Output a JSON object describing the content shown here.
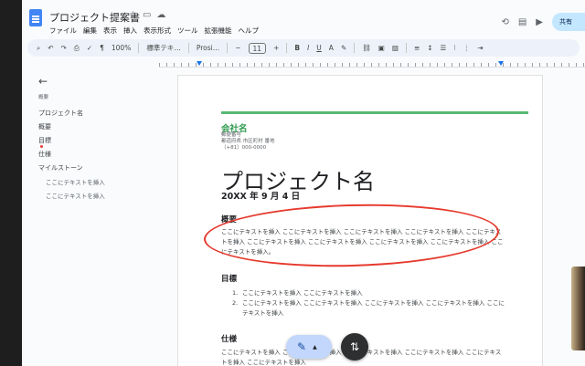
{
  "document": {
    "title": "プロジェクト提案書"
  },
  "menu": [
    "ファイル",
    "編集",
    "表示",
    "挿入",
    "表示形式",
    "ツール",
    "拡張機能",
    "ヘルプ"
  ],
  "share": {
    "label": "共有"
  },
  "toolbar": {
    "zoom": "100%",
    "style": "標準テキ…",
    "font": "Prosi…",
    "font_size": "11",
    "bold": "B",
    "italic": "I",
    "underline": "U",
    "text_color": "A"
  },
  "outline": {
    "back": "←",
    "header": "概要",
    "items": [
      {
        "label": "プロジェクト名"
      },
      {
        "label": "概要"
      },
      {
        "label": "目標"
      },
      {
        "label": "仕様"
      },
      {
        "label": "マイルストーン"
      },
      {
        "label": "ここにテキストを挿入"
      },
      {
        "label": "ここにテキストを挿入"
      }
    ]
  },
  "page": {
    "company": "会社名",
    "address_lines": [
      "郵便番号",
      "都道府県 市区町村 番地",
      "（+81）000-0000"
    ],
    "project_title": "プロジェクト名",
    "date": "20XX 年 9 月 4 日",
    "overview_heading": "概要",
    "overview_text": "ここにテキストを挿入 ここにテキストを挿入 ここにテキストを挿入 ここにテキストを挿入 ここにテキストを挿入 ここにテキストを挿入 ここにテキストを挿入 ここにテキストを挿入 ここにテキストを挿入 ここにテキストを挿入。",
    "goal_heading": "目標",
    "goal_items": [
      {
        "num": "1.",
        "text": "ここにテキストを挿入 ここにテキストを挿入"
      },
      {
        "num": "2.",
        "text": "ここにテキストを挿入 ここにテキストを挿入 ここにテキストを挿入 ここにテキストを挿入 ここにテキストを挿入"
      }
    ],
    "spec_heading": "仕様",
    "spec_text": "ここにテキストを挿入 ここにテキストを挿入 ここにテキストを挿入 ここにテキストを挿入 ここにテキストを挿入 ここにテキストを挿入"
  },
  "colors": {
    "accent_green": "#5bb974",
    "annotation_red": "#e63a2e",
    "toolbar_bg": "#edf2fa",
    "share_bg": "#c2e7ff"
  },
  "icons": [
    "docs-logo-icon",
    "star-icon",
    "move-to-folder-icon",
    "cloud-status-icon",
    "history-icon",
    "comment-icon",
    "meet-icon",
    "search-icon",
    "undo-icon",
    "redo-icon",
    "print-icon",
    "spellcheck-icon",
    "paint-format-icon",
    "pencil-icon",
    "swap-icon"
  ]
}
